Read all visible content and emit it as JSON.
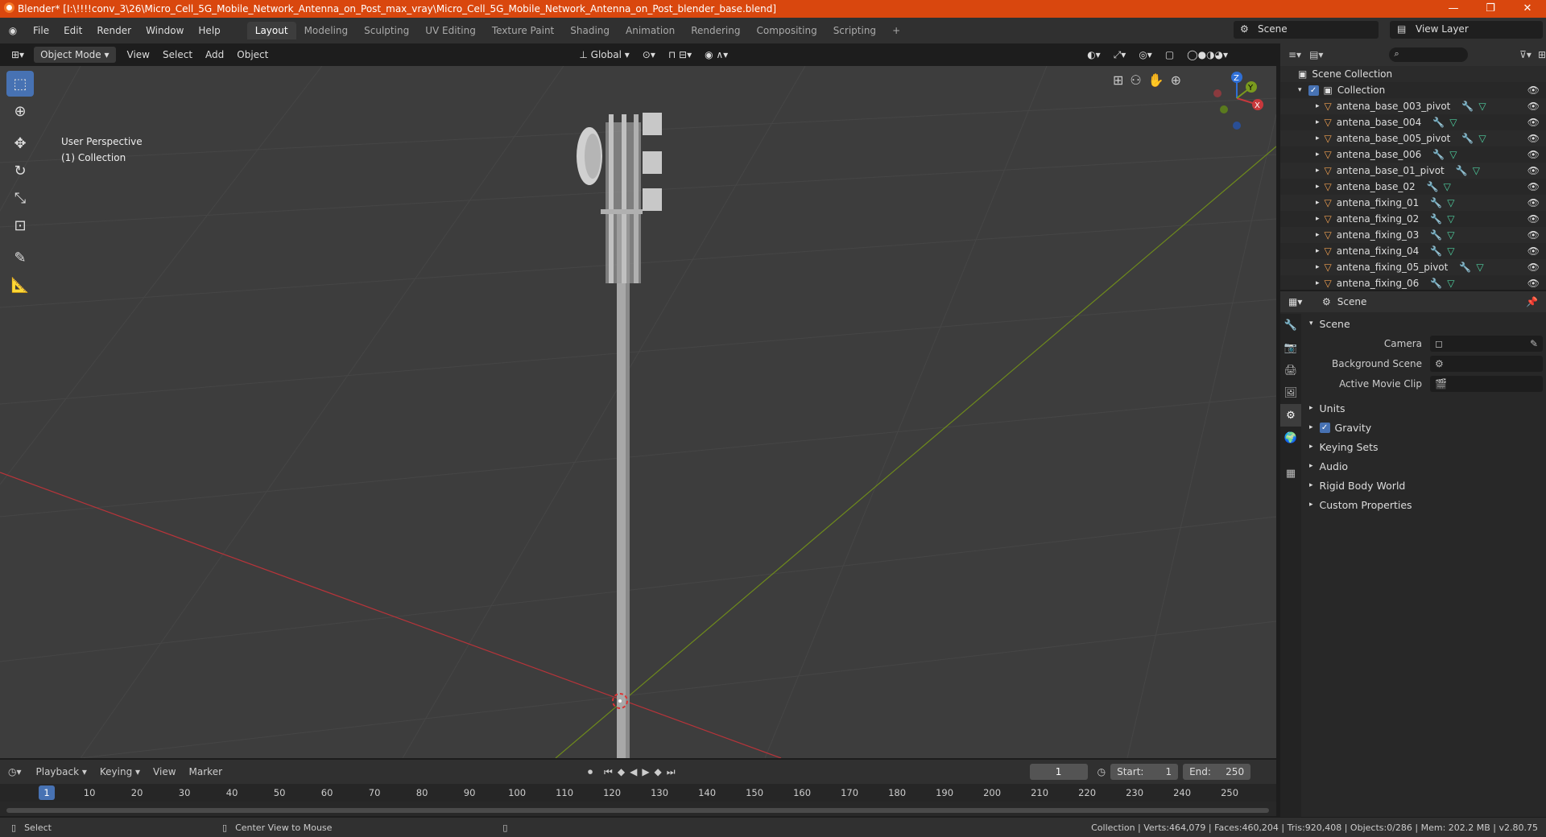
{
  "title": "Blender* [I:\\!!!!conv_3\\26\\Micro_Cell_5G_Mobile_Network_Antenna_on_Post_max_vray\\Micro_Cell_5G_Mobile_Network_Antenna_on_Post_blender_base.blend]",
  "menu": [
    "File",
    "Edit",
    "Render",
    "Window",
    "Help"
  ],
  "workspaces": [
    "Layout",
    "Modeling",
    "Sculpting",
    "UV Editing",
    "Texture Paint",
    "Shading",
    "Animation",
    "Rendering",
    "Compositing",
    "Scripting"
  ],
  "scene_name": "Scene",
  "view_layer": "View Layer",
  "viewport": {
    "mode": "Object Mode",
    "menus": [
      "View",
      "Select",
      "Add",
      "Object"
    ],
    "orientation": "Global",
    "perspective": "User Perspective",
    "collection": "(1) Collection",
    "gizmo": {
      "x": "X",
      "y": "Y",
      "z": "Z"
    }
  },
  "outliner": {
    "root": "Scene Collection",
    "collection": "Collection",
    "items": [
      "antena_base_003_pivot",
      "antena_base_004",
      "antena_base_005_pivot",
      "antena_base_006",
      "antena_base_01_pivot",
      "antena_base_02",
      "antena_fixing_01",
      "antena_fixing_02",
      "antena_fixing_03",
      "antena_fixing_04",
      "antena_fixing_05_pivot",
      "antena_fixing_06"
    ]
  },
  "properties": {
    "header": "Scene",
    "section": "Scene",
    "camera_label": "Camera",
    "bg_scene_label": "Background Scene",
    "movie_clip_label": "Active Movie Clip",
    "subpanels": [
      "Units",
      "Gravity",
      "Keying Sets",
      "Audio",
      "Rigid Body World",
      "Custom Properties"
    ],
    "gravity_checked": true
  },
  "timeline": {
    "menus": [
      "Playback",
      "Keying",
      "View",
      "Marker"
    ],
    "current_frame": "1",
    "start_label": "Start:",
    "start": "1",
    "end_label": "End:",
    "end": "250",
    "ticks": [
      "10",
      "20",
      "30",
      "40",
      "50",
      "60",
      "70",
      "80",
      "90",
      "100",
      "110",
      "120",
      "130",
      "140",
      "150",
      "160",
      "170",
      "180",
      "190",
      "200",
      "210",
      "220",
      "230",
      "240",
      "250"
    ]
  },
  "status": {
    "left": "Select",
    "middle": "Center View to Mouse",
    "stats": "Collection | Verts:464,079 | Faces:460,204 | Tris:920,408 | Objects:0/286 | Mem: 202.2 MB | v2.80.75"
  },
  "colors": {
    "accent": "#4772b3",
    "titlebar": "#d9470e",
    "x_axis": "#c8383c",
    "y_axis": "#7a9a1e",
    "z_axis": "#2f6fd6"
  }
}
